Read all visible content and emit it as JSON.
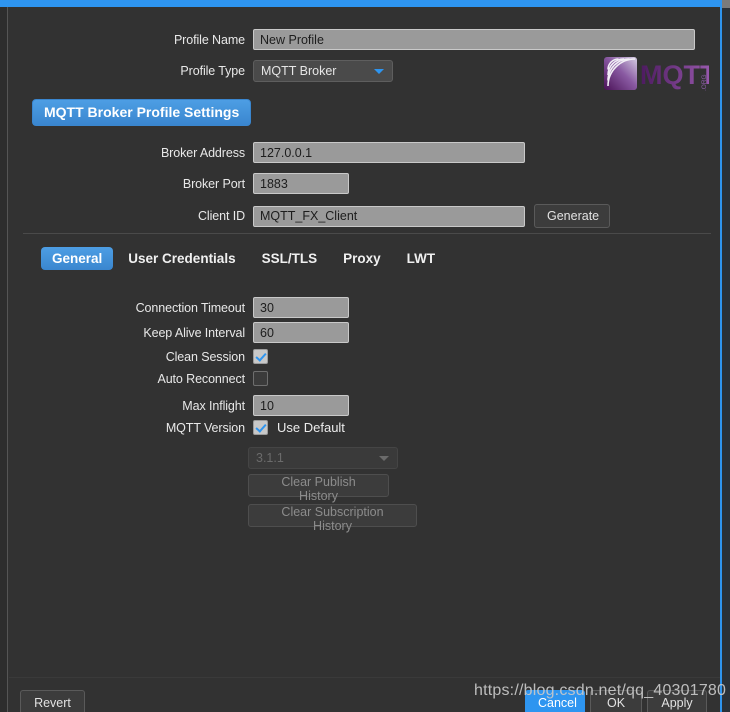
{
  "header": {
    "profile_name_label": "Profile Name",
    "profile_name_value": "New Profile",
    "profile_type_label": "Profile Type",
    "profile_type_value": "MQTT Broker",
    "logo_text": "MQTT",
    "logo_suffix": ".ORG"
  },
  "section": {
    "title": "MQTT Broker Profile Settings",
    "broker_address_label": "Broker Address",
    "broker_address_value": "127.0.0.1",
    "broker_port_label": "Broker Port",
    "broker_port_value": "1883",
    "client_id_label": "Client ID",
    "client_id_value": "MQTT_FX_Client",
    "generate_label": "Generate"
  },
  "tabs": [
    {
      "label": "General",
      "active": true
    },
    {
      "label": "User Credentials",
      "active": false
    },
    {
      "label": "SSL/TLS",
      "active": false
    },
    {
      "label": "Proxy",
      "active": false
    },
    {
      "label": "LWT",
      "active": false
    }
  ],
  "general": {
    "connection_timeout_label": "Connection Timeout",
    "connection_timeout_value": "30",
    "keep_alive_label": "Keep Alive Interval",
    "keep_alive_value": "60",
    "clean_session_label": "Clean Session",
    "clean_session_checked": true,
    "auto_reconnect_label": "Auto Reconnect",
    "auto_reconnect_checked": false,
    "max_inflight_label": "Max Inflight",
    "max_inflight_value": "10",
    "mqtt_version_label": "MQTT Version",
    "use_default_label": "Use Default",
    "use_default_checked": true,
    "version_value": "3.1.1",
    "clear_publish_label": "Clear Publish History",
    "clear_subscription_label": "Clear Subscription History"
  },
  "footer": {
    "revert_label": "Revert",
    "cancel_label": "Cancel",
    "ok_label": "OK",
    "apply_label": "Apply"
  },
  "watermark": "https://blog.csdn.net/qq_40301780",
  "colors": {
    "accent_blue": "#2e95f0",
    "panel_bg": "#323232",
    "field_bg": "#9a9a9a",
    "logo_purple": "#6b2d82"
  }
}
